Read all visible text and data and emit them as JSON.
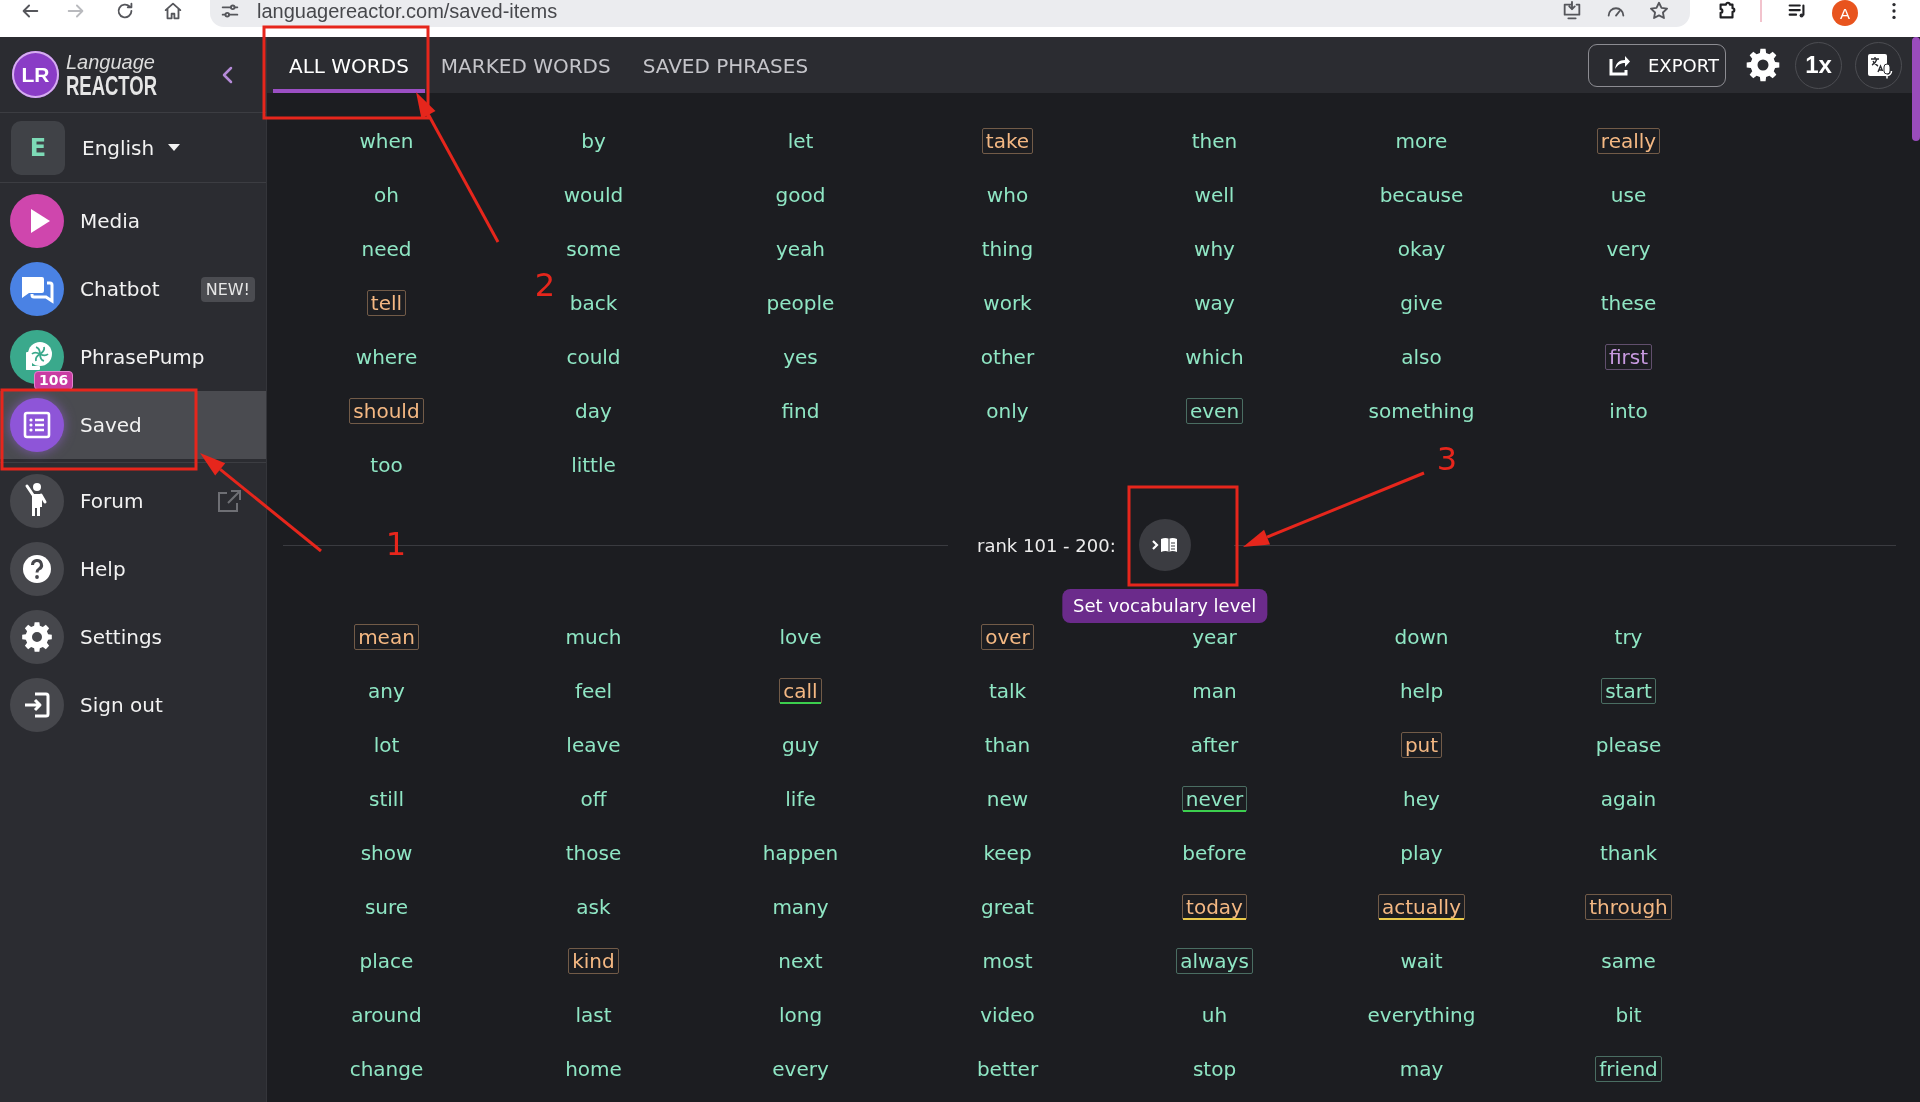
{
  "browser": {
    "url": "languagereactor.com/saved-items",
    "forward_disabled": true,
    "profile_initial": "A"
  },
  "sidebar": {
    "logo": {
      "mark": "LR",
      "line_1": "Language",
      "line_2": "REACTOR"
    },
    "language": {
      "initial": "E",
      "name": "English"
    },
    "nav": [
      {
        "label": "Media",
        "color": "#cf46ad",
        "selected": false
      },
      {
        "label": "Chatbot",
        "color": "#4a82e4",
        "badge": "NEW!",
        "selected": false
      },
      {
        "label": "PhrasePump",
        "color": "#3aa98c",
        "count": "106",
        "selected": false
      },
      {
        "label": "Saved",
        "color": "#8e55d8",
        "selected": true
      }
    ],
    "links": [
      {
        "label": "Forum",
        "external": true,
        "selected": false
      },
      {
        "label": "Help",
        "external": false,
        "selected": false
      },
      {
        "label": "Settings",
        "external": false,
        "selected": false
      },
      {
        "label": "Sign out",
        "external": false,
        "selected": false
      }
    ]
  },
  "header": {
    "tabs": [
      {
        "label": "ALL WORDS",
        "selected": true
      },
      {
        "label": "MARKED WORDS",
        "selected": false
      },
      {
        "label": "SAVED PHRASES",
        "selected": false
      }
    ],
    "export_label": "EXPORT",
    "speed": "1x"
  },
  "groups": [
    {
      "words": [
        {
          "text": "when",
          "color": "#8fe6c4",
          "boxed": false
        },
        {
          "text": "by",
          "color": "#8fe6c4",
          "boxed": false
        },
        {
          "text": "let",
          "color": "#8fe6c4",
          "boxed": false
        },
        {
          "text": "take",
          "color": "#f4b883",
          "boxed": true
        },
        {
          "text": "then",
          "color": "#8fe6c4",
          "boxed": false
        },
        {
          "text": "more",
          "color": "#8fe6c4",
          "boxed": false
        },
        {
          "text": "really",
          "color": "#f4b883",
          "boxed": true
        },
        {
          "text": "oh",
          "color": "#8fe6c4",
          "boxed": false
        },
        {
          "text": "would",
          "color": "#8fe6c4",
          "boxed": false
        },
        {
          "text": "good",
          "color": "#8fe6c4",
          "boxed": false
        },
        {
          "text": "who",
          "color": "#8fe6c4",
          "boxed": false
        },
        {
          "text": "well",
          "color": "#8fe6c4",
          "boxed": false
        },
        {
          "text": "because",
          "color": "#8fe6c4",
          "boxed": false
        },
        {
          "text": "use",
          "color": "#8fe6c4",
          "boxed": false
        },
        {
          "text": "need",
          "color": "#8fe6c4",
          "boxed": false
        },
        {
          "text": "some",
          "color": "#8fe6c4",
          "boxed": false
        },
        {
          "text": "yeah",
          "color": "#8fe6c4",
          "boxed": false
        },
        {
          "text": "thing",
          "color": "#8fe6c4",
          "boxed": false
        },
        {
          "text": "why",
          "color": "#8fe6c4",
          "boxed": false
        },
        {
          "text": "okay",
          "color": "#8fe6c4",
          "boxed": false
        },
        {
          "text": "very",
          "color": "#8fe6c4",
          "boxed": false
        },
        {
          "text": "tell",
          "color": "#f4b883",
          "boxed": true
        },
        {
          "text": "back",
          "color": "#8fe6c4",
          "boxed": false
        },
        {
          "text": "people",
          "color": "#8fe6c4",
          "boxed": false
        },
        {
          "text": "work",
          "color": "#8fe6c4",
          "boxed": false
        },
        {
          "text": "way",
          "color": "#8fe6c4",
          "boxed": false
        },
        {
          "text": "give",
          "color": "#8fe6c4",
          "boxed": false
        },
        {
          "text": "these",
          "color": "#8fe6c4",
          "boxed": false
        },
        {
          "text": "where",
          "color": "#8fe6c4",
          "boxed": false
        },
        {
          "text": "could",
          "color": "#8fe6c4",
          "boxed": false
        },
        {
          "text": "yes",
          "color": "#8fe6c4",
          "boxed": false
        },
        {
          "text": "other",
          "color": "#8fe6c4",
          "boxed": false
        },
        {
          "text": "which",
          "color": "#8fe6c4",
          "boxed": false
        },
        {
          "text": "also",
          "color": "#8fe6c4",
          "boxed": false
        },
        {
          "text": "first",
          "color": "#c89ae0",
          "boxed": true
        },
        {
          "text": "should",
          "color": "#f4b883",
          "boxed": true
        },
        {
          "text": "day",
          "color": "#8fe6c4",
          "boxed": false
        },
        {
          "text": "find",
          "color": "#8fe6c4",
          "boxed": false
        },
        {
          "text": "only",
          "color": "#8fe6c4",
          "boxed": false
        },
        {
          "text": "even",
          "color": "#8fe6c4",
          "boxed": true
        },
        {
          "text": "something",
          "color": "#8fe6c4",
          "boxed": false
        },
        {
          "text": "into",
          "color": "#8fe6c4",
          "boxed": false
        },
        {
          "text": "too",
          "color": "#8fe6c4",
          "boxed": false
        },
        {
          "text": "little",
          "color": "#8fe6c4",
          "boxed": false
        }
      ]
    },
    {
      "rank_label": "rank 101 - 200:",
      "tooltip": "Set vocabulary level",
      "words": [
        {
          "text": "mean",
          "color": "#f4b883",
          "boxed": true
        },
        {
          "text": "much",
          "color": "#8fe6c4",
          "boxed": false
        },
        {
          "text": "love",
          "color": "#8fe6c4",
          "boxed": false
        },
        {
          "text": "over",
          "color": "#f4b883",
          "boxed": true
        },
        {
          "text": "year",
          "color": "#8fe6c4",
          "boxed": false
        },
        {
          "text": "down",
          "color": "#8fe6c4",
          "boxed": false
        },
        {
          "text": "try",
          "color": "#8fe6c4",
          "boxed": false
        },
        {
          "text": "any",
          "color": "#8fe6c4",
          "boxed": false
        },
        {
          "text": "feel",
          "color": "#8fe6c4",
          "boxed": false
        },
        {
          "text": "call",
          "color": "#f4b883",
          "boxed": true,
          "underline": {
            "color": "#3ccf4e"
          }
        },
        {
          "text": "talk",
          "color": "#8fe6c4",
          "boxed": false
        },
        {
          "text": "man",
          "color": "#8fe6c4",
          "boxed": false
        },
        {
          "text": "help",
          "color": "#8fe6c4",
          "boxed": false
        },
        {
          "text": "start",
          "color": "#8fe6c4",
          "boxed": true
        },
        {
          "text": "lot",
          "color": "#8fe6c4",
          "boxed": false
        },
        {
          "text": "leave",
          "color": "#8fe6c4",
          "boxed": false
        },
        {
          "text": "guy",
          "color": "#8fe6c4",
          "boxed": false
        },
        {
          "text": "than",
          "color": "#8fe6c4",
          "boxed": false
        },
        {
          "text": "after",
          "color": "#8fe6c4",
          "boxed": false
        },
        {
          "text": "put",
          "color": "#f4b883",
          "boxed": true
        },
        {
          "text": "please",
          "color": "#8fe6c4",
          "boxed": false
        },
        {
          "text": "still",
          "color": "#8fe6c4",
          "boxed": false
        },
        {
          "text": "off",
          "color": "#8fe6c4",
          "boxed": false
        },
        {
          "text": "life",
          "color": "#8fe6c4",
          "boxed": false
        },
        {
          "text": "new",
          "color": "#8fe6c4",
          "boxed": false
        },
        {
          "text": "never",
          "color": "#8fe6c4",
          "boxed": true,
          "underline": {
            "color": "#3ccf4e"
          }
        },
        {
          "text": "hey",
          "color": "#8fe6c4",
          "boxed": false
        },
        {
          "text": "again",
          "color": "#8fe6c4",
          "boxed": false
        },
        {
          "text": "show",
          "color": "#8fe6c4",
          "boxed": false
        },
        {
          "text": "those",
          "color": "#8fe6c4",
          "boxed": false
        },
        {
          "text": "happen",
          "color": "#8fe6c4",
          "boxed": false
        },
        {
          "text": "keep",
          "color": "#8fe6c4",
          "boxed": false
        },
        {
          "text": "before",
          "color": "#8fe6c4",
          "boxed": false
        },
        {
          "text": "play",
          "color": "#8fe6c4",
          "boxed": false
        },
        {
          "text": "thank",
          "color": "#8fe6c4",
          "boxed": false
        },
        {
          "text": "sure",
          "color": "#8fe6c4",
          "boxed": false
        },
        {
          "text": "ask",
          "color": "#8fe6c4",
          "boxed": false
        },
        {
          "text": "many",
          "color": "#8fe6c4",
          "boxed": false
        },
        {
          "text": "great",
          "color": "#8fe6c4",
          "boxed": false
        },
        {
          "text": "today",
          "color": "#f4b883",
          "boxed": true,
          "underline": {
            "color": "#e9c94b"
          }
        },
        {
          "text": "actually",
          "color": "#f4b883",
          "boxed": true,
          "underline": {
            "color": "#e9c94b"
          }
        },
        {
          "text": "through",
          "color": "#f4b883",
          "boxed": true
        },
        {
          "text": "place",
          "color": "#8fe6c4",
          "boxed": false
        },
        {
          "text": "kind",
          "color": "#f4b883",
          "boxed": true
        },
        {
          "text": "next",
          "color": "#8fe6c4",
          "boxed": false
        },
        {
          "text": "most",
          "color": "#8fe6c4",
          "boxed": false
        },
        {
          "text": "always",
          "color": "#8fe6c4",
          "boxed": true
        },
        {
          "text": "wait",
          "color": "#8fe6c4",
          "boxed": false
        },
        {
          "text": "same",
          "color": "#8fe6c4",
          "boxed": false
        },
        {
          "text": "around",
          "color": "#8fe6c4",
          "boxed": false
        },
        {
          "text": "last",
          "color": "#8fe6c4",
          "boxed": false
        },
        {
          "text": "long",
          "color": "#8fe6c4",
          "boxed": false
        },
        {
          "text": "video",
          "color": "#8fe6c4",
          "boxed": false
        },
        {
          "text": "uh",
          "color": "#8fe6c4",
          "boxed": false
        },
        {
          "text": "everything",
          "color": "#8fe6c4",
          "boxed": false
        },
        {
          "text": "bit",
          "color": "#8fe6c4",
          "boxed": false
        },
        {
          "text": "change",
          "color": "#8fe6c4",
          "boxed": false
        },
        {
          "text": "home",
          "color": "#8fe6c4",
          "boxed": false
        },
        {
          "text": "every",
          "color": "#8fe6c4",
          "boxed": false
        },
        {
          "text": "better",
          "color": "#8fe6c4",
          "boxed": false
        },
        {
          "text": "stop",
          "color": "#8fe6c4",
          "boxed": false
        },
        {
          "text": "may",
          "color": "#8fe6c4",
          "boxed": false
        },
        {
          "text": "friend",
          "color": "#8fe6c4",
          "boxed": true
        }
      ]
    }
  ],
  "annotations": [
    {
      "label": "1"
    },
    {
      "label": "2"
    },
    {
      "label": "3"
    }
  ]
}
